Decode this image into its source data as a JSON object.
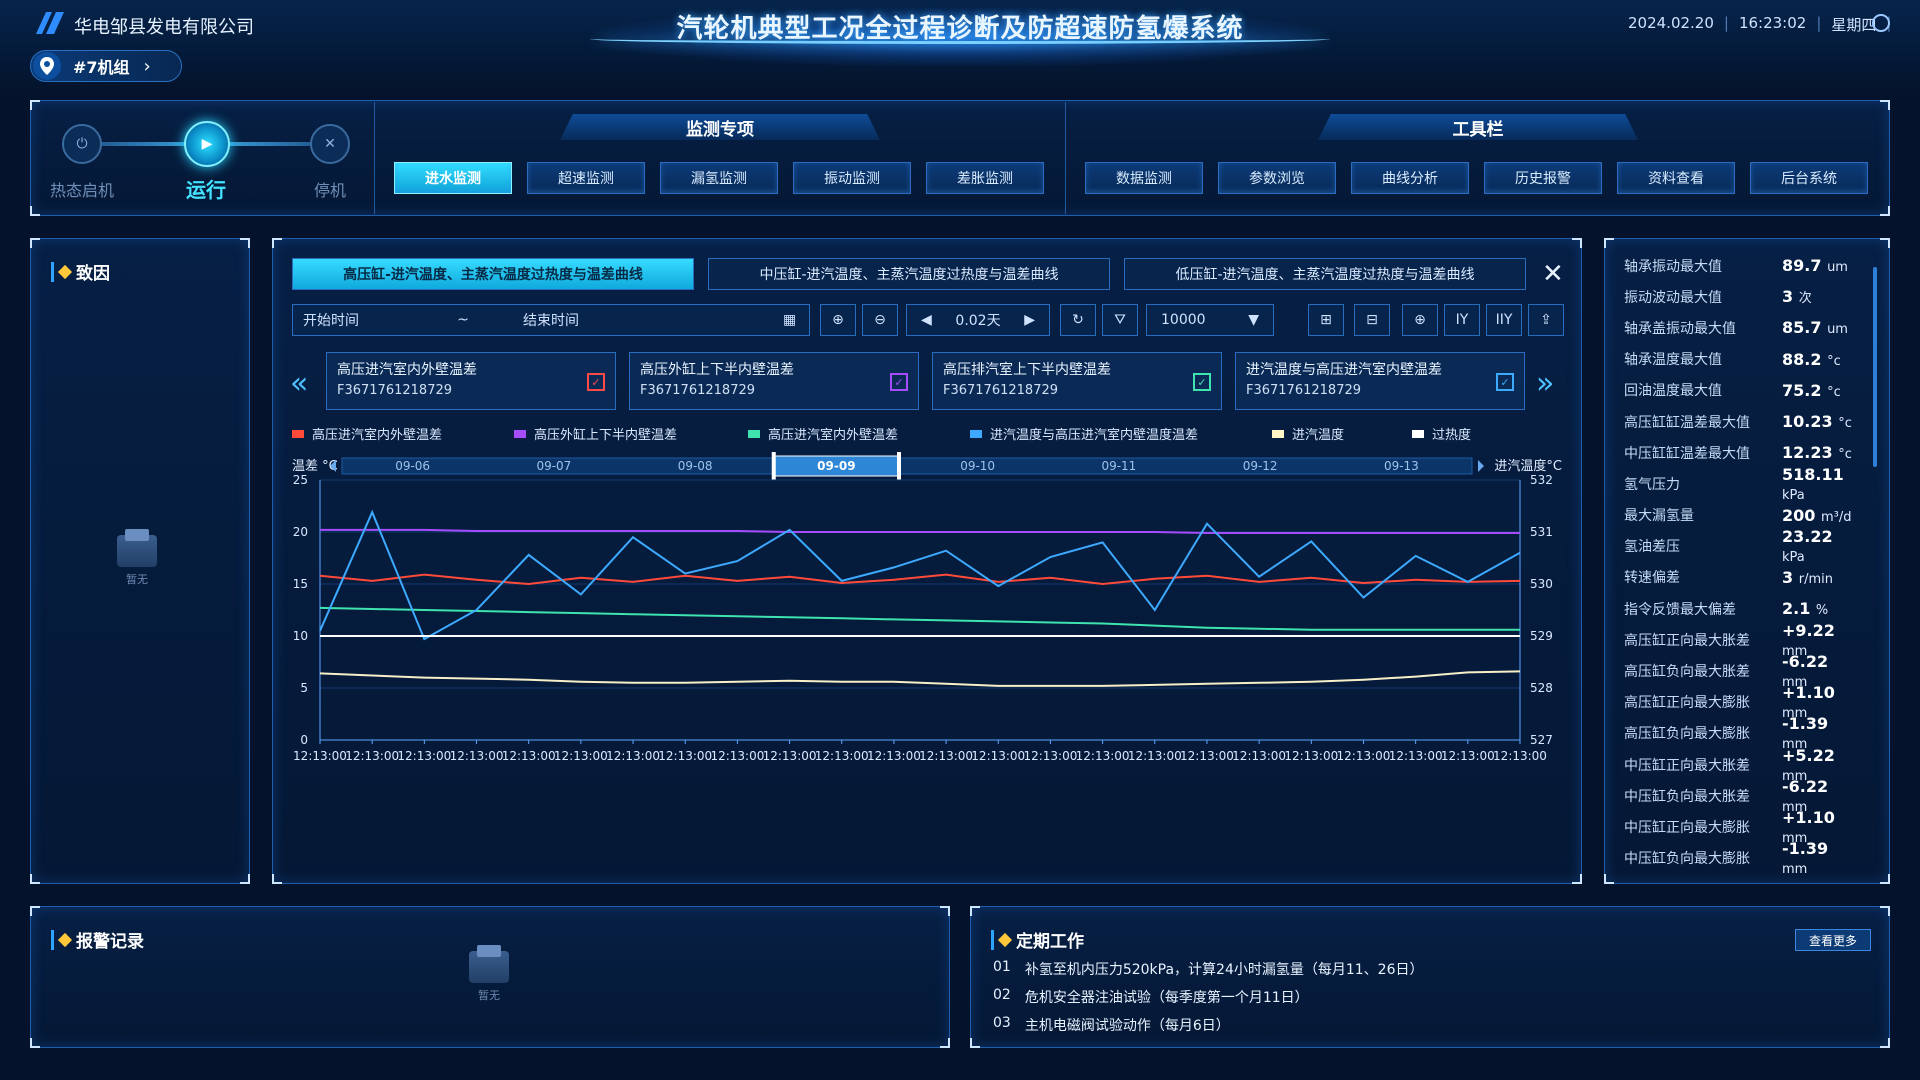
{
  "header": {
    "company": "华电邹县发电有限公司",
    "title": "汽轮机典型工况全过程诊断及防超速防氢爆系统",
    "date": "2024.02.20",
    "time": "16:23:02",
    "weekday": "星期四",
    "unit": "#7机组"
  },
  "states": [
    {
      "label": "热态启机",
      "icon": "⏻",
      "active": false
    },
    {
      "label": "运行",
      "icon": "▶",
      "active": true
    },
    {
      "label": "停机",
      "icon": "✕",
      "active": false
    }
  ],
  "monitor": {
    "title": "监测专项",
    "buttons": [
      "进水监测",
      "超速监测",
      "漏氢监测",
      "振动监测",
      "差胀监测"
    ],
    "active_index": 0
  },
  "toolbar": {
    "title": "工具栏",
    "buttons": [
      "数据监测",
      "参数浏览",
      "曲线分析",
      "历史报警",
      "资料查看",
      "后台系统"
    ]
  },
  "cause_panel": {
    "title": "致因",
    "empty": "暂无"
  },
  "alarm_panel": {
    "title": "报警记录",
    "empty": "暂无"
  },
  "periodic_panel": {
    "title": "定期工作",
    "more": "查看更多",
    "tasks": [
      {
        "no": "01",
        "text": "补氢至机内压力520kPa，计算24小时漏氢量（每月11、26日）"
      },
      {
        "no": "02",
        "text": "危机安全器注油试验（每季度第一个月11日）"
      },
      {
        "no": "03",
        "text": "主机电磁阀试验动作（每月6日）"
      }
    ]
  },
  "chart_panel": {
    "tabs": [
      "高压缸-进汽温度、主蒸汽温度过热度与温差曲线",
      "中压缸-进汽温度、主蒸汽温度过热度与温差曲线",
      "低压缸-进汽温度、主蒸汽温度过热度与温差曲线"
    ],
    "active_tab": 0,
    "start_time": "开始时间",
    "tilde": "~",
    "end_time": "结束时间",
    "step": "0.02天",
    "count": "10000",
    "signals": [
      {
        "name": "高压进汽室内外壁温差",
        "code": "F3671761218729",
        "color": "#ff4040"
      },
      {
        "name": "高压外缸上下半内壁温差",
        "code": "F3671761218729",
        "color": "#a040ff"
      },
      {
        "name": "高压排汽室上下半内壁温差",
        "code": "F3671761218729",
        "color": "#3ee0b0"
      },
      {
        "name": "进汽温度与高压进汽室内壁温差",
        "code": "F3671761218729",
        "color": "#4aa8ff"
      }
    ]
  },
  "metrics": [
    {
      "label": "轴承振动最大值",
      "value": "89.7",
      "unit": "um"
    },
    {
      "label": "振动波动最大值",
      "value": "3",
      "unit": "次"
    },
    {
      "label": "轴承盖振动最大值",
      "value": "85.7",
      "unit": "um"
    },
    {
      "label": "轴承温度最大值",
      "value": "88.2",
      "unit": "°c"
    },
    {
      "label": "回油温度最大值",
      "value": "75.2",
      "unit": "°c"
    },
    {
      "label": "高压缸缸温差最大值",
      "value": "10.23",
      "unit": "°c"
    },
    {
      "label": "中压缸缸温差最大值",
      "value": "12.23",
      "unit": "°c"
    },
    {
      "label": "氢气压力",
      "value": "518.11",
      "unit": "kPa"
    },
    {
      "label": "最大漏氢量",
      "value": "200",
      "unit": "m³/d"
    },
    {
      "label": "氢油差压",
      "value": "23.22",
      "unit": "kPa"
    },
    {
      "label": "转速偏差",
      "value": "3",
      "unit": "r/min"
    },
    {
      "label": "指令反馈最大偏差",
      "value": "2.1",
      "unit": "%"
    },
    {
      "label": "高压缸正向最大胀差",
      "value": "+9.22",
      "unit": "mm"
    },
    {
      "label": "高压缸负向最大胀差",
      "value": "-6.22",
      "unit": "mm"
    },
    {
      "label": "高压缸正向最大膨胀",
      "value": "+1.10",
      "unit": "mm"
    },
    {
      "label": "高压缸负向最大膨胀",
      "value": "-1.39",
      "unit": "mm"
    },
    {
      "label": "中压缸正向最大胀差",
      "value": "+5.22",
      "unit": "mm"
    },
    {
      "label": "中压缸负向最大胀差",
      "value": "-6.22",
      "unit": "mm"
    },
    {
      "label": "中压缸正向最大膨胀",
      "value": "+1.10",
      "unit": "mm"
    },
    {
      "label": "中压缸负向最大膨胀",
      "value": "-1.39",
      "unit": "mm"
    }
  ],
  "colors": {
    "accent": "#2ee0ff",
    "panel_border": "#1d5fae"
  },
  "chart_data": {
    "type": "line",
    "ylabel_left": "温差 °C",
    "ylabel_right": "进汽温度°C",
    "ylim_left": [
      0,
      25
    ],
    "ylim_right": [
      527,
      532
    ],
    "yticks_left": [
      "0",
      "5",
      "10",
      "15",
      "20",
      "25"
    ],
    "yticks_right": [
      "527",
      "528",
      "529",
      "530",
      "531",
      "532"
    ],
    "x_ticks": [
      "12:13:00",
      "12:13:00",
      "12:13:00",
      "12:13:00",
      "12:13:00",
      "12:13:00",
      "12:13:00",
      "12:13:00",
      "12:13:00",
      "12:13:00",
      "12:13:00",
      "12:13:00",
      "12:13:00",
      "12:13:00",
      "12:13:00",
      "12:13:00",
      "12:13:00",
      "12:13:00",
      "12:13:00",
      "12:13:00",
      "12:13:00",
      "12:13:00",
      "12:13:00",
      "12:13:00"
    ],
    "range_dates": [
      "09-06",
      "09-07",
      "09-08",
      "09-09",
      "09-10",
      "09-11",
      "09-12",
      "09-13"
    ],
    "range_selected": "09-09",
    "legend": [
      "高压进汽室内外壁温差",
      "高压外缸上下半内壁温差",
      "高压进汽室内外壁温差",
      "进汽温度与高压进汽室内壁温度温差",
      "进汽温度",
      "过热度"
    ],
    "series": [
      {
        "name": "高压进汽室内外壁温差",
        "color": "#ff4a3a",
        "axis": "left",
        "values": [
          15.8,
          15.3,
          15.9,
          15.4,
          15.0,
          15.6,
          15.2,
          15.8,
          15.3,
          15.7,
          15.1,
          15.4,
          15.9,
          15.2,
          15.6,
          15.0,
          15.5,
          15.8,
          15.2,
          15.6,
          15.1,
          15.4,
          15.2,
          15.3
        ]
      },
      {
        "name": "高压外缸上下半内壁温差",
        "color": "#a54cff",
        "axis": "left",
        "values": [
          20.2,
          20.2,
          20.2,
          20.1,
          20.1,
          20.1,
          20.1,
          20.1,
          20.1,
          20.0,
          20.0,
          20.0,
          20.0,
          20.0,
          20.0,
          20.0,
          20.0,
          19.9,
          19.9,
          19.9,
          19.9,
          19.9,
          19.9,
          19.9
        ]
      },
      {
        "name": "高压进汽室内外壁温差",
        "color": "#3fe3b0",
        "axis": "left",
        "values": [
          12.7,
          12.6,
          12.5,
          12.4,
          12.3,
          12.2,
          12.1,
          12.0,
          11.9,
          11.8,
          11.7,
          11.6,
          11.5,
          11.4,
          11.3,
          11.2,
          11.0,
          10.8,
          10.7,
          10.6,
          10.6,
          10.6,
          10.6,
          10.6
        ]
      },
      {
        "name": "进汽温度与高压进汽室内壁温度温差",
        "color": "#3da9ff",
        "axis": "left",
        "values": [
          10.5,
          21.9,
          9.7,
          12.5,
          17.8,
          14.0,
          19.5,
          16.0,
          17.2,
          20.2,
          15.3,
          16.6,
          18.2,
          14.8,
          17.6,
          19.0,
          12.5,
          20.8,
          15.7,
          19.1,
          13.7,
          17.7,
          15.2,
          18.0
        ]
      },
      {
        "name": "进汽温度",
        "color": "#ffffff",
        "axis": "right",
        "values": [
          529.0,
          529.0,
          529.0,
          529.0,
          529.0,
          529.0,
          529.0,
          529.0,
          529.0,
          529.0,
          529.0,
          529.0,
          529.0,
          529.0,
          529.0,
          529.0,
          529.0,
          529.0,
          529.0,
          529.0,
          529.0,
          529.0,
          529.0,
          529.0
        ]
      },
      {
        "name": "过热度",
        "color": "#f6efc8",
        "axis": "left",
        "values": [
          6.4,
          6.2,
          6.0,
          5.9,
          5.8,
          5.6,
          5.5,
          5.5,
          5.6,
          5.7,
          5.6,
          5.6,
          5.4,
          5.2,
          5.2,
          5.2,
          5.3,
          5.4,
          5.5,
          5.6,
          5.8,
          6.1,
          6.5,
          6.6
        ]
      }
    ]
  }
}
